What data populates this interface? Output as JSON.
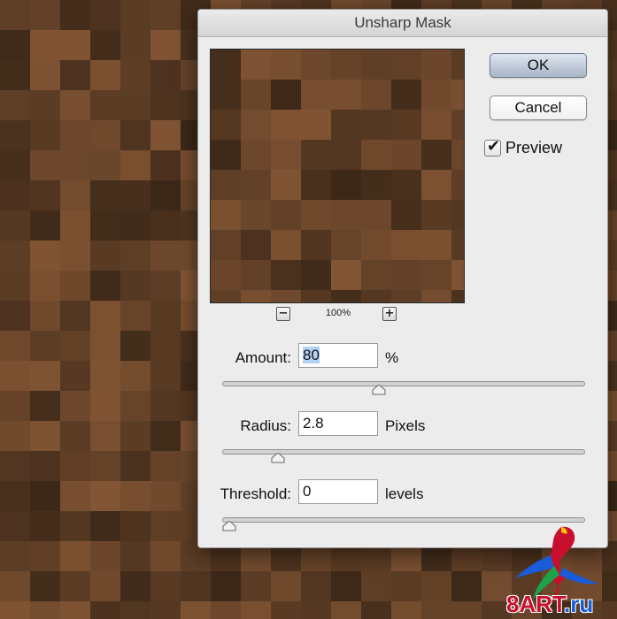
{
  "dialog": {
    "title": "Unsharp Mask",
    "ok_label": "OK",
    "cancel_label": "Cancel",
    "preview": {
      "label": "Preview",
      "checked": true
    },
    "zoom": {
      "level": "100%",
      "zoom_out_symbol": "−",
      "zoom_in_symbol": "+"
    },
    "fields": [
      {
        "id": "amount",
        "label": "Amount:",
        "value": "80",
        "unit": "%",
        "slider_fraction": 0.43
      },
      {
        "id": "radius",
        "label": "Radius:",
        "value": "2.8",
        "unit": "Pixels",
        "slider_fraction": 0.14
      },
      {
        "id": "threshold",
        "label": "Threshold:",
        "value": "0",
        "unit": "levels",
        "slider_fraction": 0.0
      }
    ]
  },
  "watermark": {
    "brand": "8ART",
    "suffix": ".ru",
    "icon": "parrot-logo-icon"
  },
  "colors": {
    "default_button": "#a7b5c7",
    "selection": "#b3d0f5",
    "logo_red": "#c8102e",
    "logo_blue": "#1a5bd8"
  }
}
